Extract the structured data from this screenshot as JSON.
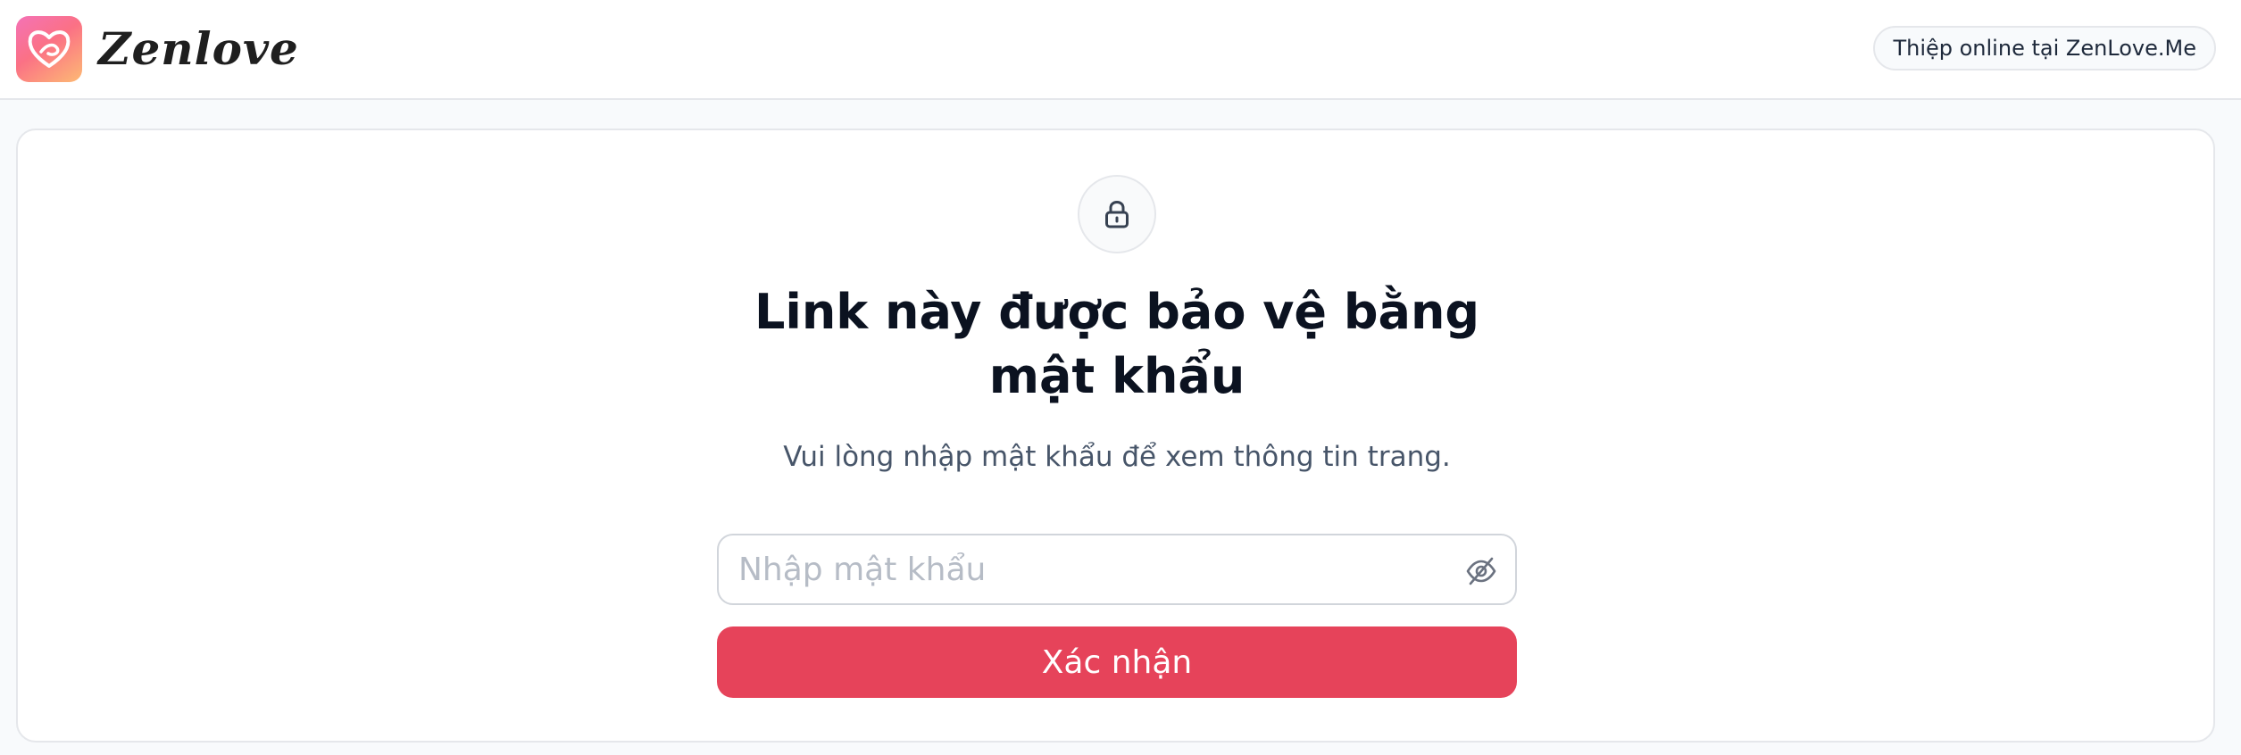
{
  "header": {
    "brand_name": "Zenlove",
    "logo_icon": "heart-logo-icon",
    "promo_link": "Thiệp online tại ZenLove.Me"
  },
  "main": {
    "lock_icon": "lock-icon",
    "title": "Link này được bảo vệ bằng mật khẩu",
    "subtitle": "Vui lòng nhập mật khẩu để xem thông tin trang.",
    "password_field": {
      "value": "",
      "placeholder": "Nhập mật khẩu",
      "toggle_icon": "eye-off-icon"
    },
    "submit_label": "Xác nhận"
  },
  "colors": {
    "accent": "#e6435a",
    "logo_gradient_start": "#f472b6",
    "logo_gradient_end": "#fdba74",
    "page_background": "#f8fafc",
    "border": "#e5e7eb"
  }
}
